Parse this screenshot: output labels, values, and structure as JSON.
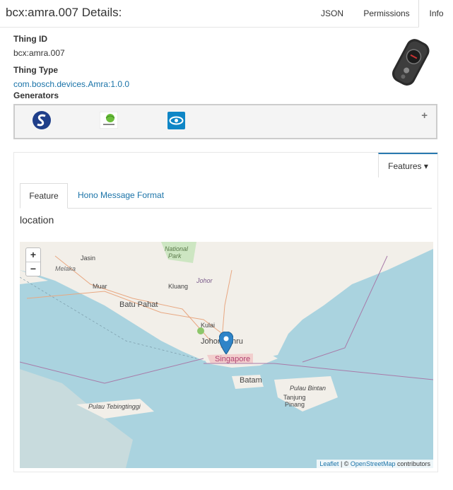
{
  "header": {
    "title": "bcx:amra.007 Details:",
    "tabs": [
      {
        "label": "JSON"
      },
      {
        "label": "Permissions"
      },
      {
        "label": "Info"
      }
    ]
  },
  "info": {
    "thing_id_label": "Thing ID",
    "thing_id": "bcx:amra.007",
    "thing_type_label": "Thing Type",
    "thing_type": "com.bosch.devices.Amra:1.0.0",
    "generators_label": "Generators",
    "generators": [
      {
        "icon": "s-logo-icon"
      },
      {
        "icon": "globe-generator-icon"
      },
      {
        "icon": "eye-generator-icon"
      }
    ],
    "device_image_icon": "device-photo-icon"
  },
  "features_panel": {
    "dropdown_label": "Features ▾",
    "tabs": [
      {
        "label": "Feature"
      },
      {
        "label": "Hono Message Format"
      }
    ],
    "feature_name": "location"
  },
  "map": {
    "zoom_in": "+",
    "zoom_out": "−",
    "attribution_link1": "Leaflet",
    "attribution_sep": " | © ",
    "attribution_link2": "OpenStreetMap",
    "attribution_tail": " contributors",
    "labels": {
      "jasin": "Jasin",
      "melaka": "Melaka",
      "national_park": "National",
      "park": "Park",
      "johor": "Johor",
      "muar": "Muar",
      "kluang": "Kluang",
      "batu_pahat": "Batu Pahat",
      "kulai": "Kulai",
      "johor_bahru": "Johor Bahru",
      "singapore": "Singapore",
      "batam": "Batam",
      "pulau_bintan": "Pulau Bintan",
      "tanjung": "Tanjung",
      "pinang": "Pinang",
      "pulau_tebingtinggi": "Pulau Tebingtinggi"
    }
  }
}
